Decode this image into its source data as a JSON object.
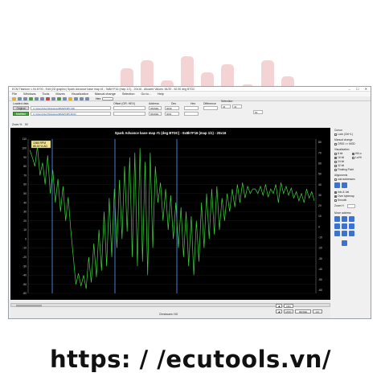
{
  "window": {
    "title": "ECM Titanium 1.94.6700 - Edit (2D graphic) Spark Advance base map #1 - 0x8kYF16 (map 1/1) - 20x16 - Allowed Values: 64/20 - 62.50 deg BTDC",
    "controls": "– ☐ ✕"
  },
  "menu": [
    "File",
    "Windows",
    "Tools",
    "Moves",
    "Visualization",
    "Manual change",
    "Selection",
    "Go to...",
    "Help"
  ],
  "toolbar": {
    "hex_label": "Hex",
    "offset_label": "Offset (OR: HEX)",
    "address_label": "Address",
    "dec_label": "Dec",
    "hex_col_label": "Hex",
    "difference_label": "Difference",
    "selection_label": "Selection"
  },
  "loaded": {
    "heading": "Loaded data",
    "original_button": "Original",
    "modified_button": "Modified",
    "original_path": "C:\\Users\\Nuch\\Desktop\\BMW\\N55.ORI",
    "modified_path": "C:\\Users\\Nuch\\Desktop\\BMW\\N55.MOD",
    "address_orig": "06202E",
    "address_mod": "06202E",
    "dec_orig": "0030",
    "dec_mod": "0031",
    "sel_a": "44",
    "sel_b": "44",
    "sel_c": "60"
  },
  "zoom": {
    "label": "Zoom %",
    "value": "50"
  },
  "chart_data": {
    "type": "line",
    "title": "Spark Advance base map #1 (deg BTDC) - 0x8kYF16 (map 1/1) - 20x16",
    "info_rpm": "1066 RPM",
    "info_val": "85.00 % AD",
    "ylim": [
      -60,
      110
    ],
    "yticks": [
      "110",
      "100",
      "90",
      "80",
      "70",
      "60",
      "50",
      "40",
      "30",
      "20",
      "10",
      "0",
      "-10",
      "-20",
      "-30",
      "-40",
      "-50",
      "-60"
    ],
    "yticks_right": [
      "80",
      "70",
      "60",
      "50",
      "40",
      "30",
      "20",
      "10",
      "0",
      "-10",
      "-20",
      "-30",
      "-40",
      "-50",
      "-60"
    ],
    "xlabel": "Checksums: NO",
    "markers_x": [
      30,
      108,
      185
    ],
    "series": [
      {
        "color": "#3fd43f",
        "values": [
          98,
          90,
          80,
          102,
          70,
          84,
          60,
          92,
          50,
          76,
          40,
          66,
          30,
          58,
          20,
          46,
          10,
          -20,
          -50,
          -38,
          -52,
          -40,
          -55,
          -20,
          -48,
          -5,
          -42,
          10,
          -35,
          30,
          -30,
          45,
          -20,
          55,
          -10,
          65,
          0,
          80,
          8,
          90,
          -20,
          95,
          -30,
          100,
          -25,
          85,
          -40,
          95,
          -10,
          80,
          40,
          62,
          20,
          55,
          10,
          48,
          0,
          40,
          -10,
          35,
          -20,
          30,
          -30,
          25,
          -40,
          20,
          -25,
          40,
          -10,
          50,
          0,
          55,
          5,
          58,
          10,
          45,
          20,
          50,
          30,
          55,
          35,
          60,
          40,
          62,
          45,
          58,
          50,
          55,
          55,
          50,
          58,
          48,
          60,
          46,
          55,
          50,
          60,
          40,
          62,
          50,
          58,
          48,
          56,
          45,
          52,
          42,
          50,
          40,
          55,
          45,
          52,
          42
        ]
      }
    ]
  },
  "right": {
    "cursor_heading": "Cursor",
    "lock_label": "Lock (Ctrl+L)",
    "manual_heading": "Manual change",
    "manual_opt": "ORIG >> MOD",
    "vis_heading": "Visualization",
    "vis_opts": [
      "8 bit",
      "16 bit",
      "24 bit",
      "32 bit"
    ],
    "vis_extra": [
      "Hi/Lo",
      "Lo/Hi",
      "Floating Point"
    ],
    "align_heading": "Alignments",
    "align_val": "odd addresses",
    "checks": [
      "Info & Val",
      "Over bytemap",
      "Smooth"
    ],
    "zoom_label": "Zoom H",
    "move_heading": "Move address"
  },
  "bottom": {
    "crc_label": "CRC",
    "mod_label": "MOD",
    "address_value": "06202E",
    "go_label": "GO"
  },
  "watermark": {
    "url": "https: / /ecutools.vn/"
  }
}
